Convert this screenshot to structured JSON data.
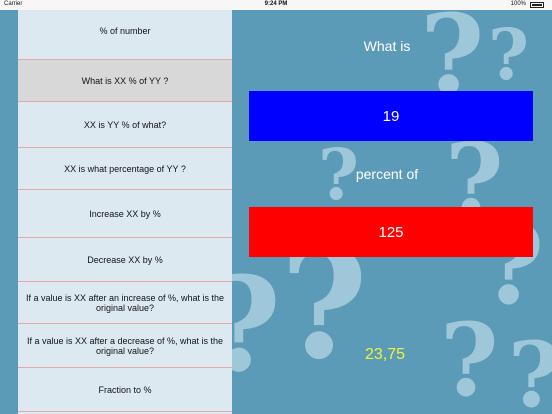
{
  "status_bar": {
    "carrier": "Carrier",
    "time": "9:24 PM",
    "battery": "100%"
  },
  "menu": {
    "items": [
      {
        "label": "% of number",
        "selected": false
      },
      {
        "label": "What is XX % of YY ?",
        "selected": true
      },
      {
        "label": "XX is YY % of what?",
        "selected": false
      },
      {
        "label": "XX is what percentage of YY ?",
        "selected": false
      },
      {
        "label": "Increase XX by %",
        "selected": false
      },
      {
        "label": "Decrease XX by %",
        "selected": false
      },
      {
        "label": "If a value is XX after an increase of %, what is the original value?",
        "selected": false
      },
      {
        "label": "If a value is XX after a decrease of %, what is the original value?",
        "selected": false
      },
      {
        "label": "Fraction to %",
        "selected": false
      }
    ]
  },
  "calculator": {
    "prompt": "What is",
    "first_value": "19",
    "connector": "percent of",
    "second_value": "125",
    "result": "23,75"
  },
  "colors": {
    "background": "#5c9bb8",
    "menu_background": "#dde9f1",
    "first_value_bg": "#0000ff",
    "second_value_bg": "#ff0000",
    "result_text": "#f2f23a",
    "selected_item": "#d8d8d8"
  }
}
